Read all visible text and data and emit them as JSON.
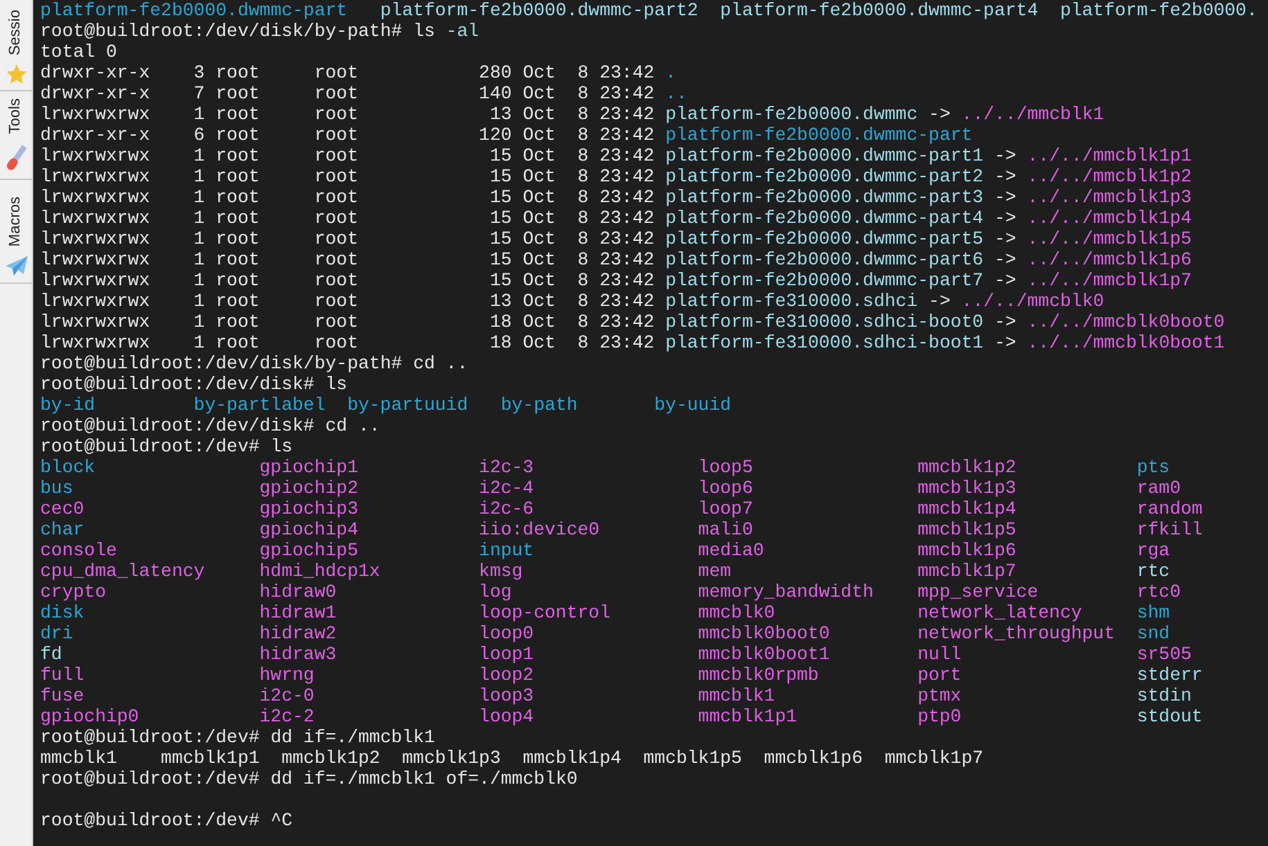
{
  "sidebar": {
    "tabs": [
      {
        "label": "Sessio"
      },
      {
        "label": "Tools"
      },
      {
        "label": "Macros"
      }
    ]
  },
  "terminal": {
    "lines": [
      {
        "kind": "listing",
        "rows": [
          [
            {
              "text": "platform-fe2b0000.dwmmc-part",
              "color": "#2aa7d6"
            },
            {
              "text": "platform-fe2b0000.dwmmc-part2",
              "color": "#9fdcec"
            },
            {
              "text": "platform-fe2b0000.dwmmc-part4",
              "color": "#9fdcec"
            },
            {
              "text": "platform-fe2b0000.",
              "color": "#9fdcec"
            }
          ]
        ]
      },
      {
        "kind": "text",
        "segments": [
          {
            "text": "root@buildroot:/dev/disk/by-path# ls ",
            "color": "#e6e6e6"
          },
          {
            "text": "-al",
            "color": "#9fdcdc"
          }
        ]
      },
      {
        "kind": "text",
        "segments": [
          {
            "text": "total 0",
            "color": "#e6e6e6"
          }
        ]
      },
      {
        "kind": "text",
        "segments": [
          {
            "text": "drwxr-xr-x    3 root     root           280 Oct  8 23:42 ",
            "color": "#e6e6e6"
          },
          {
            "text": ".",
            "color": "#2aa7d6"
          }
        ]
      },
      {
        "kind": "text",
        "segments": [
          {
            "text": "drwxr-xr-x    7 root     root           140 Oct  8 23:42 ",
            "color": "#e6e6e6"
          },
          {
            "text": "..",
            "color": "#2aa7d6"
          }
        ]
      },
      {
        "kind": "text",
        "segments": [
          {
            "text": "lrwxrwxrwx    1 root     root            13 Oct  8 23:42 ",
            "color": "#e6e6e6"
          },
          {
            "text": "platform-fe2b0000.dwmmc",
            "color": "#9fdcec"
          },
          {
            "text": " -> ",
            "color": "#e6e6e6"
          },
          {
            "text": "../../mmcblk1",
            "color": "#e060e6"
          }
        ]
      },
      {
        "kind": "text",
        "segments": [
          {
            "text": "drwxr-xr-x    6 root     root           120 Oct  8 23:42 ",
            "color": "#e6e6e6"
          },
          {
            "text": "platform-fe2b0000.dwmmc-part",
            "color": "#2aa7d6"
          }
        ]
      },
      {
        "kind": "text",
        "segments": [
          {
            "text": "lrwxrwxrwx    1 root     root            15 Oct  8 23:42 ",
            "color": "#e6e6e6"
          },
          {
            "text": "platform-fe2b0000.dwmmc-part1",
            "color": "#9fdcec"
          },
          {
            "text": " -> ",
            "color": "#e6e6e6"
          },
          {
            "text": "../../mmcblk1p1",
            "color": "#e060e6"
          }
        ]
      },
      {
        "kind": "text",
        "segments": [
          {
            "text": "lrwxrwxrwx    1 root     root            15 Oct  8 23:42 ",
            "color": "#e6e6e6"
          },
          {
            "text": "platform-fe2b0000.dwmmc-part2",
            "color": "#9fdcec"
          },
          {
            "text": " -> ",
            "color": "#e6e6e6"
          },
          {
            "text": "../../mmcblk1p2",
            "color": "#e060e6"
          }
        ]
      },
      {
        "kind": "text",
        "segments": [
          {
            "text": "lrwxrwxrwx    1 root     root            15 Oct  8 23:42 ",
            "color": "#e6e6e6"
          },
          {
            "text": "platform-fe2b0000.dwmmc-part3",
            "color": "#9fdcec"
          },
          {
            "text": " -> ",
            "color": "#e6e6e6"
          },
          {
            "text": "../../mmcblk1p3",
            "color": "#e060e6"
          }
        ]
      },
      {
        "kind": "text",
        "segments": [
          {
            "text": "lrwxrwxrwx    1 root     root            15 Oct  8 23:42 ",
            "color": "#e6e6e6"
          },
          {
            "text": "platform-fe2b0000.dwmmc-part4",
            "color": "#9fdcec"
          },
          {
            "text": " -> ",
            "color": "#e6e6e6"
          },
          {
            "text": "../../mmcblk1p4",
            "color": "#e060e6"
          }
        ]
      },
      {
        "kind": "text",
        "segments": [
          {
            "text": "lrwxrwxrwx    1 root     root            15 Oct  8 23:42 ",
            "color": "#e6e6e6"
          },
          {
            "text": "platform-fe2b0000.dwmmc-part5",
            "color": "#9fdcec"
          },
          {
            "text": " -> ",
            "color": "#e6e6e6"
          },
          {
            "text": "../../mmcblk1p5",
            "color": "#e060e6"
          }
        ]
      },
      {
        "kind": "text",
        "segments": [
          {
            "text": "lrwxrwxrwx    1 root     root            15 Oct  8 23:42 ",
            "color": "#e6e6e6"
          },
          {
            "text": "platform-fe2b0000.dwmmc-part6",
            "color": "#9fdcec"
          },
          {
            "text": " -> ",
            "color": "#e6e6e6"
          },
          {
            "text": "../../mmcblk1p6",
            "color": "#e060e6"
          }
        ]
      },
      {
        "kind": "text",
        "segments": [
          {
            "text": "lrwxrwxrwx    1 root     root            15 Oct  8 23:42 ",
            "color": "#e6e6e6"
          },
          {
            "text": "platform-fe2b0000.dwmmc-part7",
            "color": "#9fdcec"
          },
          {
            "text": " -> ",
            "color": "#e6e6e6"
          },
          {
            "text": "../../mmcblk1p7",
            "color": "#e060e6"
          }
        ]
      },
      {
        "kind": "text",
        "segments": [
          {
            "text": "lrwxrwxrwx    1 root     root            13 Oct  8 23:42 ",
            "color": "#e6e6e6"
          },
          {
            "text": "platform-fe310000.sdhci",
            "color": "#9fdcec"
          },
          {
            "text": " -> ",
            "color": "#e6e6e6"
          },
          {
            "text": "../../mmcblk0",
            "color": "#e060e6"
          }
        ]
      },
      {
        "kind": "text",
        "segments": [
          {
            "text": "lrwxrwxrwx    1 root     root            18 Oct  8 23:42 ",
            "color": "#e6e6e6"
          },
          {
            "text": "platform-fe310000.sdhci-boot0",
            "color": "#9fdcec"
          },
          {
            "text": " -> ",
            "color": "#e6e6e6"
          },
          {
            "text": "../../mmcblk0boot0",
            "color": "#e060e6"
          }
        ]
      },
      {
        "kind": "text",
        "segments": [
          {
            "text": "lrwxrwxrwx    1 root     root            18 Oct  8 23:42 ",
            "color": "#e6e6e6"
          },
          {
            "text": "platform-fe310000.sdhci-boot1",
            "color": "#9fdcec"
          },
          {
            "text": " -> ",
            "color": "#e6e6e6"
          },
          {
            "text": "../../mmcblk0boot1",
            "color": "#e060e6"
          }
        ]
      },
      {
        "kind": "text",
        "segments": [
          {
            "text": "root@buildroot:/dev/disk/by-path# cd ..",
            "color": "#e6e6e6"
          }
        ]
      },
      {
        "kind": "text",
        "segments": [
          {
            "text": "root@buildroot:/dev/disk# ls",
            "color": "#e6e6e6"
          }
        ]
      },
      {
        "kind": "listing",
        "rows": [
          [
            {
              "text": "by-id",
              "color": "#2aa7d6"
            },
            {
              "text": "by-partlabel",
              "color": "#2aa7d6"
            },
            {
              "text": "by-partuuid",
              "color": "#2aa7d6"
            },
            {
              "text": "by-path",
              "color": "#2aa7d6"
            },
            {
              "text": "by-uuid",
              "color": "#2aa7d6"
            }
          ]
        ]
      },
      {
        "kind": "text",
        "segments": [
          {
            "text": "root@buildroot:/dev/disk# cd ..",
            "color": "#e6e6e6"
          }
        ]
      },
      {
        "kind": "text",
        "segments": [
          {
            "text": "root@buildroot:/dev# ls",
            "color": "#e6e6e6"
          }
        ]
      },
      {
        "kind": "listing",
        "rows": [
          [
            {
              "text": "block",
              "color": "#2aa7d6"
            },
            {
              "text": "gpiochip1",
              "color": "#e060e6"
            },
            {
              "text": "i2c-3",
              "color": "#e060e6"
            },
            {
              "text": "loop5",
              "color": "#e060e6"
            },
            {
              "text": "mmcblk1p2",
              "color": "#e060e6"
            },
            {
              "text": "pts",
              "color": "#2aa7d6"
            }
          ],
          [
            {
              "text": "bus",
              "color": "#2aa7d6"
            },
            {
              "text": "gpiochip2",
              "color": "#e060e6"
            },
            {
              "text": "i2c-4",
              "color": "#e060e6"
            },
            {
              "text": "loop6",
              "color": "#e060e6"
            },
            {
              "text": "mmcblk1p3",
              "color": "#e060e6"
            },
            {
              "text": "ram0",
              "color": "#e060e6"
            }
          ],
          [
            {
              "text": "cec0",
              "color": "#e060e6"
            },
            {
              "text": "gpiochip3",
              "color": "#e060e6"
            },
            {
              "text": "i2c-6",
              "color": "#e060e6"
            },
            {
              "text": "loop7",
              "color": "#e060e6"
            },
            {
              "text": "mmcblk1p4",
              "color": "#e060e6"
            },
            {
              "text": "random",
              "color": "#e060e6"
            }
          ],
          [
            {
              "text": "char",
              "color": "#2aa7d6"
            },
            {
              "text": "gpiochip4",
              "color": "#e060e6"
            },
            {
              "text": "iio:device0",
              "color": "#e060e6"
            },
            {
              "text": "mali0",
              "color": "#e060e6"
            },
            {
              "text": "mmcblk1p5",
              "color": "#e060e6"
            },
            {
              "text": "rfkill",
              "color": "#e060e6"
            }
          ],
          [
            {
              "text": "console",
              "color": "#e060e6"
            },
            {
              "text": "gpiochip5",
              "color": "#e060e6"
            },
            {
              "text": "input",
              "color": "#2aa7d6"
            },
            {
              "text": "media0",
              "color": "#e060e6"
            },
            {
              "text": "mmcblk1p6",
              "color": "#e060e6"
            },
            {
              "text": "rga",
              "color": "#e060e6"
            }
          ],
          [
            {
              "text": "cpu_dma_latency",
              "color": "#e060e6"
            },
            {
              "text": "hdmi_hdcp1x",
              "color": "#e060e6"
            },
            {
              "text": "kmsg",
              "color": "#e060e6"
            },
            {
              "text": "mem",
              "color": "#e060e6"
            },
            {
              "text": "mmcblk1p7",
              "color": "#e060e6"
            },
            {
              "text": "rtc",
              "color": "#9fdcec"
            }
          ],
          [
            {
              "text": "crypto",
              "color": "#e060e6"
            },
            {
              "text": "hidraw0",
              "color": "#e060e6"
            },
            {
              "text": "log",
              "color": "#e060e6"
            },
            {
              "text": "memory_bandwidth",
              "color": "#e060e6"
            },
            {
              "text": "mpp_service",
              "color": "#e060e6"
            },
            {
              "text": "rtc0",
              "color": "#e060e6"
            }
          ],
          [
            {
              "text": "disk",
              "color": "#2aa7d6"
            },
            {
              "text": "hidraw1",
              "color": "#e060e6"
            },
            {
              "text": "loop-control",
              "color": "#e060e6"
            },
            {
              "text": "mmcblk0",
              "color": "#e060e6"
            },
            {
              "text": "network_latency",
              "color": "#e060e6"
            },
            {
              "text": "shm",
              "color": "#2aa7d6"
            }
          ],
          [
            {
              "text": "dri",
              "color": "#2aa7d6"
            },
            {
              "text": "hidraw2",
              "color": "#e060e6"
            },
            {
              "text": "loop0",
              "color": "#e060e6"
            },
            {
              "text": "mmcblk0boot0",
              "color": "#e060e6"
            },
            {
              "text": "network_throughput",
              "color": "#e060e6"
            },
            {
              "text": "snd",
              "color": "#2aa7d6"
            }
          ],
          [
            {
              "text": "fd",
              "color": "#9fdcec"
            },
            {
              "text": "hidraw3",
              "color": "#e060e6"
            },
            {
              "text": "loop1",
              "color": "#e060e6"
            },
            {
              "text": "mmcblk0boot1",
              "color": "#e060e6"
            },
            {
              "text": "null",
              "color": "#e060e6"
            },
            {
              "text": "sr505",
              "color": "#e060e6"
            }
          ],
          [
            {
              "text": "full",
              "color": "#e060e6"
            },
            {
              "text": "hwrng",
              "color": "#e060e6"
            },
            {
              "text": "loop2",
              "color": "#e060e6"
            },
            {
              "text": "mmcblk0rpmb",
              "color": "#e060e6"
            },
            {
              "text": "port",
              "color": "#e060e6"
            },
            {
              "text": "stderr",
              "color": "#9fdcec"
            }
          ],
          [
            {
              "text": "fuse",
              "color": "#e060e6"
            },
            {
              "text": "i2c-0",
              "color": "#e060e6"
            },
            {
              "text": "loop3",
              "color": "#e060e6"
            },
            {
              "text": "mmcblk1",
              "color": "#e060e6"
            },
            {
              "text": "ptmx",
              "color": "#e060e6"
            },
            {
              "text": "stdin",
              "color": "#9fdcec"
            }
          ],
          [
            {
              "text": "gpiochip0",
              "color": "#e060e6"
            },
            {
              "text": "i2c-2",
              "color": "#e060e6"
            },
            {
              "text": "loop4",
              "color": "#e060e6"
            },
            {
              "text": "mmcblk1p1",
              "color": "#e060e6"
            },
            {
              "text": "ptp0",
              "color": "#e060e6"
            },
            {
              "text": "stdout",
              "color": "#9fdcec"
            }
          ]
        ]
      },
      {
        "kind": "text",
        "segments": [
          {
            "text": "root@buildroot:/dev# dd if=./mmcblk1",
            "color": "#e6e6e6"
          }
        ]
      },
      {
        "kind": "listing",
        "rows": [
          [
            {
              "text": "mmcblk1",
              "color": "#e6e6e6"
            },
            {
              "text": "mmcblk1p1",
              "color": "#e6e6e6"
            },
            {
              "text": "mmcblk1p2",
              "color": "#e6e6e6"
            },
            {
              "text": "mmcblk1p3",
              "color": "#e6e6e6"
            },
            {
              "text": "mmcblk1p4",
              "color": "#e6e6e6"
            },
            {
              "text": "mmcblk1p5",
              "color": "#e6e6e6"
            },
            {
              "text": "mmcblk1p6",
              "color": "#e6e6e6"
            },
            {
              "text": "mmcblk1p7",
              "color": "#e6e6e6"
            }
          ]
        ]
      },
      {
        "kind": "text",
        "segments": [
          {
            "text": "root@buildroot:/dev# dd if=./mmcblk1 of=./mmcblk0",
            "color": "#e6e6e6"
          }
        ]
      },
      {
        "kind": "blank"
      },
      {
        "kind": "text",
        "segments": [
          {
            "text": "root@buildroot:/dev# ^C",
            "color": "#e6e6e6"
          }
        ]
      }
    ]
  }
}
